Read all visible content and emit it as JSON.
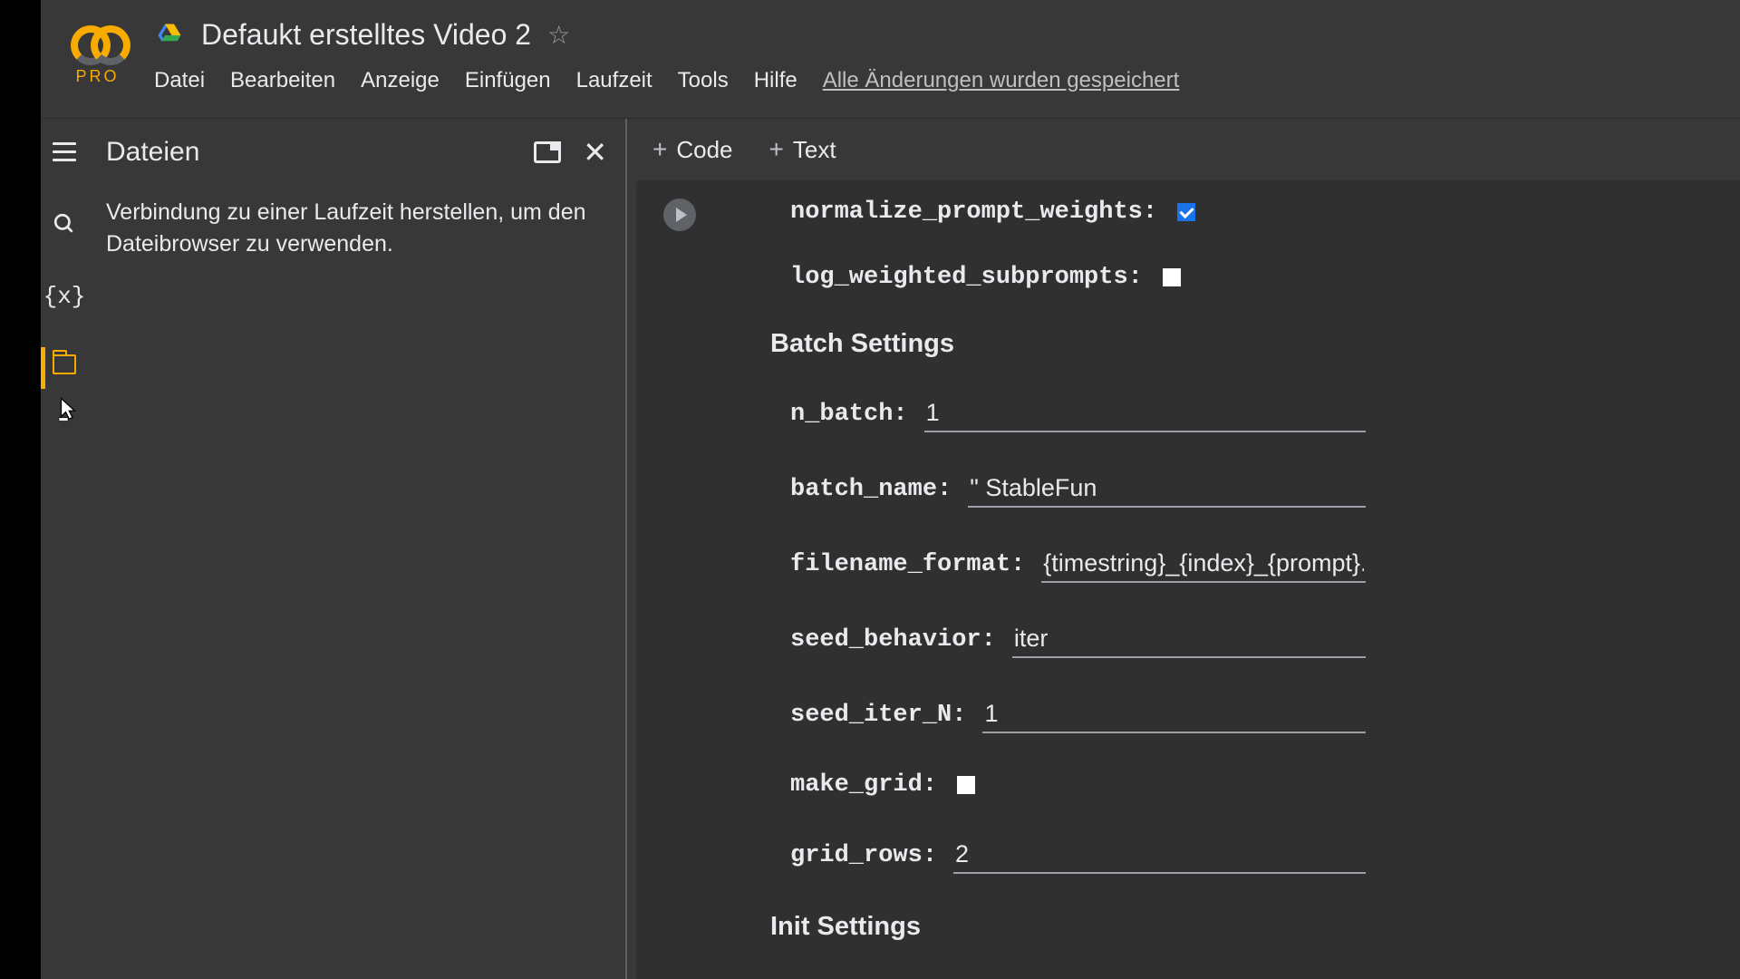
{
  "header": {
    "pro_label": "PRO",
    "title": "Defaukt erstelltes Video 2"
  },
  "menubar": {
    "items": [
      "Datei",
      "Bearbeiten",
      "Anzeige",
      "Einfügen",
      "Laufzeit",
      "Tools",
      "Hilfe"
    ],
    "saved_msg": "Alle Änderungen wurden gespeichert"
  },
  "side_panel": {
    "title": "Dateien",
    "message": "Verbindung zu einer Laufzeit herstellen, um den Dateibrowser zu verwenden."
  },
  "toolbar": {
    "code_label": "Code",
    "text_label": "Text"
  },
  "form": {
    "normalize_prompt_weights": {
      "label": "normalize_prompt_weights:",
      "checked": true
    },
    "log_weighted_subprompts": {
      "label": "log_weighted_subprompts:",
      "checked": false
    },
    "batch_section": "Batch Settings",
    "n_batch": {
      "label": "n_batch:",
      "value": "1"
    },
    "batch_name": {
      "label": "batch_name:",
      "value": "\" StableFun"
    },
    "filename_format": {
      "label": "filename_format:",
      "value": "{timestring}_{index}_{prompt}.png"
    },
    "seed_behavior": {
      "label": "seed_behavior:",
      "value": "iter"
    },
    "seed_iter_N": {
      "label": "seed_iter_N:",
      "value": "1"
    },
    "make_grid": {
      "label": "make_grid:",
      "checked": false
    },
    "grid_rows": {
      "label": "grid_rows:",
      "value": "2"
    },
    "init_section": "Init Settings"
  }
}
